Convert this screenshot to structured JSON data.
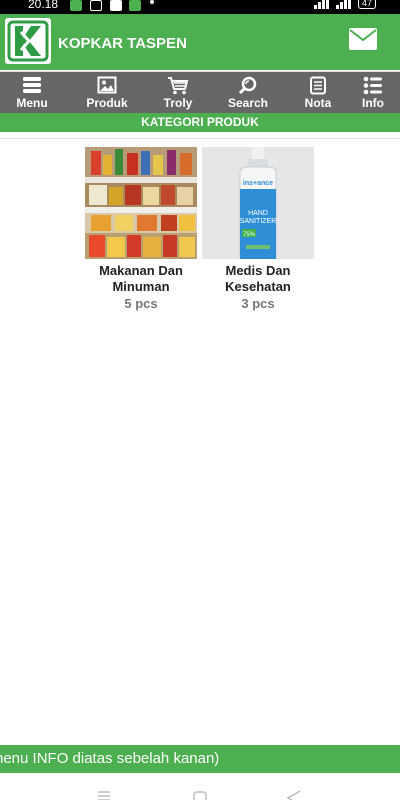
{
  "status_bar": {
    "time": "20.18",
    "battery": "47"
  },
  "app": {
    "title": "KOPKAR TASPEN"
  },
  "nav": [
    {
      "label": "Menu",
      "icon": "menu-icon"
    },
    {
      "label": "Produk",
      "icon": "image-icon"
    },
    {
      "label": "Troly",
      "icon": "cart-icon"
    },
    {
      "label": "Search",
      "icon": "search-icon"
    },
    {
      "label": "Nota",
      "icon": "receipt-icon"
    },
    {
      "label": "Info",
      "icon": "info-list-icon"
    }
  ],
  "category_header": "KATEGORI PRODUK",
  "products": [
    {
      "name_line1": "Makanan Dan",
      "name_line2": "Minuman",
      "count": "5 pcs"
    },
    {
      "name_line1": "Medis Dan",
      "name_line2": "Kesehatan",
      "count": "3 pcs",
      "image_text": {
        "brand": "ins+ance",
        "line1": "HAND",
        "line2": "SANITIZER",
        "badge": "75%"
      }
    }
  ],
  "marquee_text": "nenu INFO diatas sebelah kanan)",
  "colors": {
    "primary": "#4caf50",
    "nav_bg": "#666666"
  }
}
